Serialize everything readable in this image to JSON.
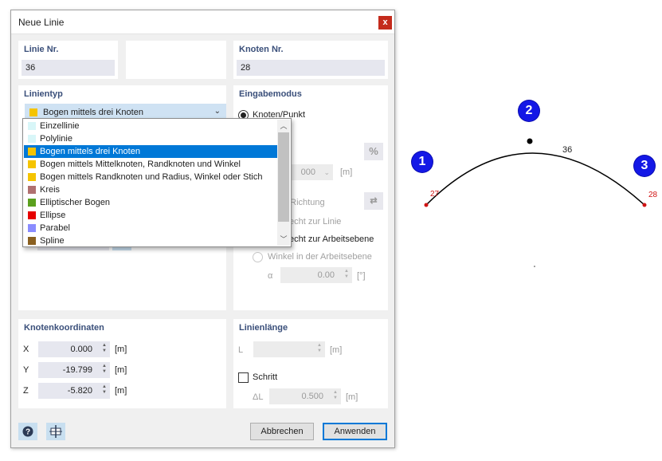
{
  "dialog": {
    "title": "Neue Linie",
    "close_label": "x",
    "line_no": {
      "label": "Linie Nr.",
      "value": "36"
    },
    "node_no": {
      "label": "Knoten Nr.",
      "value": "28"
    },
    "line_type": {
      "label": "Linientyp",
      "selected": "Bogen mittels drei Knoten",
      "options": [
        {
          "label": "Einzellinie",
          "color": "#d8f6f8"
        },
        {
          "label": "Polylinie",
          "color": "#d8f6f8"
        },
        {
          "label": "Bogen mittels drei Knoten",
          "color": "#f5c400"
        },
        {
          "label": "Bogen mittels Mittelknoten, Randknoten und Winkel",
          "color": "#f5c400"
        },
        {
          "label": "Bogen mittels Randknoten und Radius, Winkel oder Stich",
          "color": "#f5c400"
        },
        {
          "label": "Kreis",
          "color": "#b07070"
        },
        {
          "label": "Elliptischer Bogen",
          "color": "#5ba01e"
        },
        {
          "label": "Ellipse",
          "color": "#e60000"
        },
        {
          "label": "Parabel",
          "color": "#8a8cff"
        },
        {
          "label": "Spline",
          "color": "#8a6020"
        }
      ],
      "selected_index": 2
    },
    "input_mode": {
      "label": "Eingabemodus",
      "option_node": "Knoten/Punkt",
      "value_fragment": "000",
      "unit_m": "[m]",
      "direction_fragment": "d Richtung",
      "perp_line_fragment": "echt zur Linie",
      "perp_plane_fragment": "echt zur Arbeitsebene",
      "angle_in_plane": "Winkel in der Arbeitsebene",
      "alpha_label": "α",
      "alpha_value": "0.00",
      "alpha_unit": "[°]",
      "percent_icon": "%"
    },
    "node_coords": {
      "label": "Knotenkoordinaten",
      "rows": [
        {
          "axis": "X",
          "value": "0.000",
          "unit": "[m]"
        },
        {
          "axis": "Y",
          "value": "-19.799",
          "unit": "[m]"
        },
        {
          "axis": "Z",
          "value": "-5.820",
          "unit": "[m]"
        }
      ]
    },
    "line_length": {
      "label": "Linienlänge",
      "l_label": "L",
      "l_unit": "[m]",
      "step_label": "Schritt",
      "dl_label": "ΔL",
      "dl_value": "0.500",
      "dl_unit": "[m]"
    },
    "buttons": {
      "cancel": "Abbrechen",
      "apply": "Anwenden"
    },
    "icons": {
      "help": "help-icon",
      "pick": "pick-node-icon",
      "swap": "swap-direction-icon",
      "arrow_up": "▲",
      "arrow_down": "▼",
      "chevron": "⌄",
      "scroll_up": "︿",
      "scroll_down": "﹀"
    }
  },
  "viewport": {
    "badges": [
      "1",
      "2",
      "3"
    ],
    "node_labels": [
      "27",
      "28"
    ],
    "line_label": "36",
    "colors": {
      "badge": "#1418e6",
      "node": "#d01414",
      "arc": "#000000"
    }
  }
}
